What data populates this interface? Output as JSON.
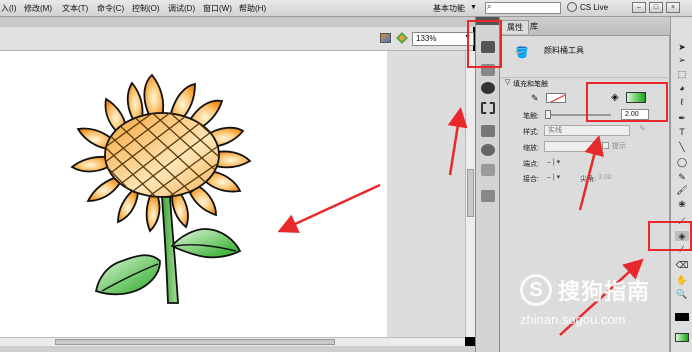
{
  "menubar": {
    "items": [
      "入(I)",
      "修改(M)",
      "文本(T)",
      "命令(C)",
      "控制(O)",
      "调试(D)",
      "窗口(W)",
      "帮助(H)"
    ],
    "workspace": "基本功能",
    "cs_live": "CS Live",
    "window_buttons": [
      "–",
      "□",
      "×"
    ]
  },
  "stage_toolbar": {
    "zoom": "133%"
  },
  "property_panel": {
    "tabs": [
      "属性",
      "库"
    ],
    "tool_name": "颜料桶工具",
    "section_title": "填充和笔触",
    "stroke_label": "笔触:",
    "stroke_width": "2.00",
    "style_label": "样式:",
    "style_value": "实线",
    "scale_label": "缩放:",
    "hint_label": "提示",
    "cap_label": "端点:",
    "cap_value": "– | ▾",
    "join_label": "接合:",
    "join_value": "– | ▾",
    "miter_label": "尖角:",
    "miter_value": "3.00",
    "fill_color": "#19a51a",
    "stroke_color": "#ffffff"
  },
  "tools": [
    "selection",
    "subselection",
    "free-transform",
    "3d-rotation",
    "lasso",
    "pen",
    "text",
    "line",
    "rectangle",
    "pencil",
    "brush",
    "deco",
    "bone",
    "paint-bucket",
    "eyedropper",
    "eraser",
    "hand",
    "zoom",
    "stroke-color",
    "fill-color"
  ],
  "watermark": {
    "logo": "S",
    "text": "搜狗指南",
    "url": "zhinan.sogou.com"
  },
  "highlight_color": "#e8282a"
}
